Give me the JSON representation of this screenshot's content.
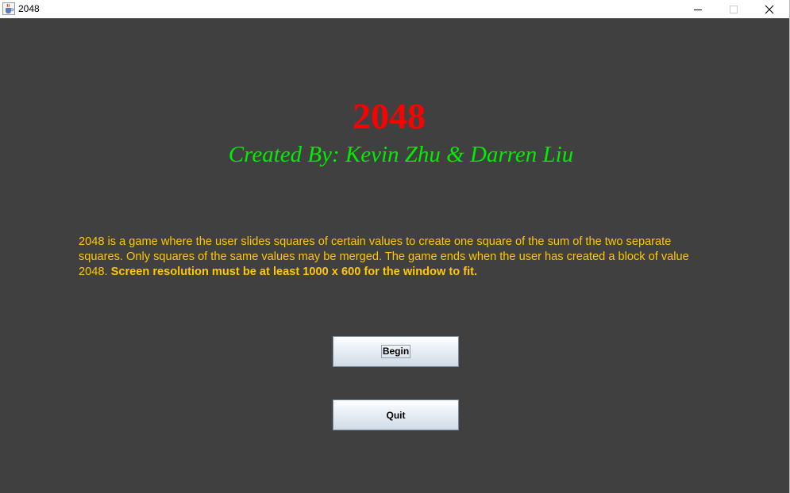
{
  "window": {
    "title": "2048",
    "icon": "java-cup-icon",
    "controls": {
      "minimize": "minimize-icon",
      "maximize": "maximize-icon",
      "close": "close-icon"
    }
  },
  "main": {
    "title": "2048",
    "credits": "Created By: Kevin Zhu & Darren Liu",
    "description": "2048 is a game where the user slides squares of certain values to create one square of the sum of the two separate squares. Only squares of the same values may be merged. The game ends when the user has created a block of value 2048.",
    "description_note": "Screen resolution must be at least 1000 x 600 for the window to fit.",
    "buttons": {
      "begin": "Begin",
      "quit": "Quit"
    }
  },
  "colors": {
    "background": "#404040",
    "title": "#ff0000",
    "credits": "#00ee00",
    "description": "#ffc800"
  }
}
